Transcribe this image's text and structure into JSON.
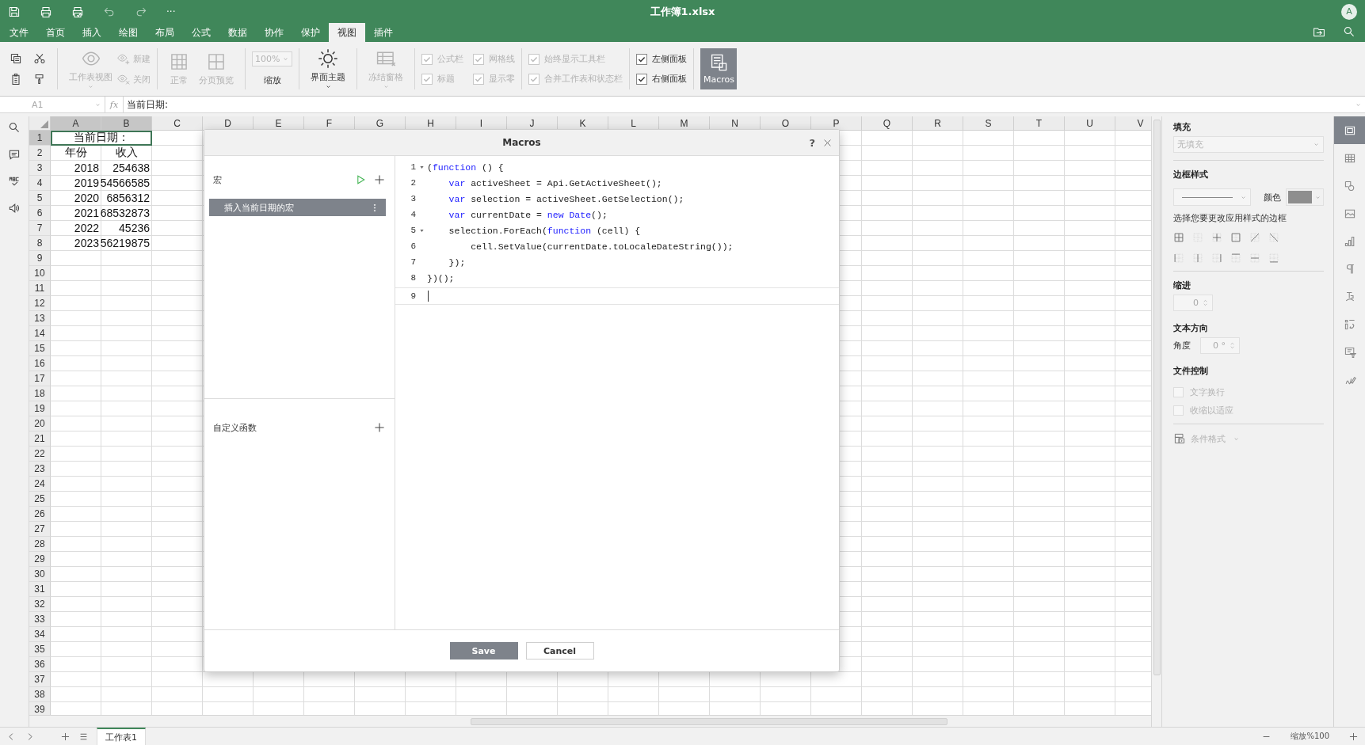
{
  "window": {
    "title": "工作簿1.xlsx",
    "more": "···",
    "avatar": "A"
  },
  "menu_tabs": [
    {
      "label": "文件",
      "selected": false
    },
    {
      "label": "首页",
      "selected": false
    },
    {
      "label": "插入",
      "selected": false
    },
    {
      "label": "绘图",
      "selected": false
    },
    {
      "label": "布局",
      "selected": false
    },
    {
      "label": "公式",
      "selected": false
    },
    {
      "label": "数据",
      "selected": false
    },
    {
      "label": "协作",
      "selected": false
    },
    {
      "label": "保护",
      "selected": false
    },
    {
      "label": "视图",
      "selected": true
    },
    {
      "label": "插件",
      "selected": false
    }
  ],
  "toolbar": {
    "sheet_view": {
      "label": "工作表视图",
      "disabled": true
    },
    "new_view": {
      "label": "新建",
      "disabled": true
    },
    "close_view": {
      "label": "关闭",
      "disabled": true
    },
    "normal": {
      "label": "正常",
      "disabled": true
    },
    "page_break": {
      "label": "分页预览",
      "disabled": true
    },
    "zoom": {
      "value": "100%",
      "label": "缩放",
      "disabled": true
    },
    "theme": {
      "label": "界面主题",
      "disabled": false
    },
    "freeze": {
      "label": "冻结窗格",
      "disabled": true
    },
    "checkbox_groups": [
      [
        {
          "label": "公式栏",
          "checked": true,
          "disabled": true
        },
        {
          "label": "标题",
          "checked": true,
          "disabled": true
        },
        {
          "label": "网格线",
          "checked": true,
          "disabled": true
        },
        {
          "label": "显示零",
          "checked": true,
          "disabled": true
        }
      ],
      [
        {
          "label": "始终显示工具栏",
          "checked": true,
          "disabled": true
        },
        {
          "label": "合并工作表和状态栏",
          "checked": true,
          "disabled": true
        }
      ],
      [
        {
          "label": "左侧面板",
          "checked": true,
          "disabled": false
        },
        {
          "label": "右侧面板",
          "checked": true,
          "disabled": false
        }
      ]
    ],
    "macros": {
      "label": "Macros",
      "selected": true
    }
  },
  "formula_bar": {
    "cell_ref": "A1",
    "fx": "fx",
    "value": "当前日期:"
  },
  "sheet": {
    "columns": [
      {
        "label": "A",
        "selected": true
      },
      {
        "label": "B",
        "selected": true
      },
      {
        "label": "C",
        "selected": false
      },
      {
        "label": "D",
        "selected": false
      },
      {
        "label": "E",
        "selected": false
      },
      {
        "label": "F",
        "selected": false
      },
      {
        "label": "G",
        "selected": false
      },
      {
        "label": "H",
        "selected": false
      },
      {
        "label": "I",
        "selected": false
      },
      {
        "label": "J",
        "selected": false
      },
      {
        "label": "K",
        "selected": false
      },
      {
        "label": "L",
        "selected": false
      },
      {
        "label": "M",
        "selected": false
      },
      {
        "label": "N",
        "selected": false
      },
      {
        "label": "O",
        "selected": false
      },
      {
        "label": "P",
        "selected": false
      },
      {
        "label": "Q",
        "selected": false
      },
      {
        "label": "R",
        "selected": false
      },
      {
        "label": "S",
        "selected": false
      },
      {
        "label": "T",
        "selected": false
      },
      {
        "label": "U",
        "selected": false
      },
      {
        "label": "V",
        "selected": false
      }
    ],
    "rows": [
      {
        "header": "1",
        "selected": true,
        "cells": [
          {
            "text": "当前日期：",
            "kind": "merged",
            "selected": true
          }
        ]
      },
      {
        "header": "2",
        "selected": false,
        "cells": [
          {
            "text": "年份",
            "kind": "text",
            "selected": false
          },
          {
            "text": "收入",
            "kind": "text",
            "selected": false
          }
        ]
      },
      {
        "header": "3",
        "selected": false,
        "cells": [
          {
            "text": "2018",
            "kind": "number",
            "selected": false
          },
          {
            "text": "254638",
            "kind": "number",
            "selected": false
          }
        ]
      },
      {
        "header": "4",
        "selected": false,
        "cells": [
          {
            "text": "2019",
            "kind": "number",
            "selected": false
          },
          {
            "text": "54566585",
            "kind": "number",
            "selected": false
          }
        ]
      },
      {
        "header": "5",
        "selected": false,
        "cells": [
          {
            "text": "2020",
            "kind": "number",
            "selected": false
          },
          {
            "text": "6856312",
            "kind": "number",
            "selected": false
          }
        ]
      },
      {
        "header": "6",
        "selected": false,
        "cells": [
          {
            "text": "2021",
            "kind": "number",
            "selected": false
          },
          {
            "text": "68532873",
            "kind": "number",
            "selected": false
          }
        ]
      },
      {
        "header": "7",
        "selected": false,
        "cells": [
          {
            "text": "2022",
            "kind": "number",
            "selected": false
          },
          {
            "text": "45236",
            "kind": "number",
            "selected": false
          }
        ]
      },
      {
        "header": "8",
        "selected": false,
        "cells": [
          {
            "text": "2023",
            "kind": "number",
            "selected": false
          },
          {
            "text": "56219875",
            "kind": "number",
            "selected": false
          }
        ]
      },
      {
        "header": "9",
        "selected": false
      },
      {
        "header": "10",
        "selected": false
      },
      {
        "header": "11",
        "selected": false
      },
      {
        "header": "12",
        "selected": false
      },
      {
        "header": "13",
        "selected": false
      },
      {
        "header": "14",
        "selected": false
      },
      {
        "header": "15",
        "selected": false
      },
      {
        "header": "16",
        "selected": false
      },
      {
        "header": "17",
        "selected": false
      },
      {
        "header": "18",
        "selected": false
      },
      {
        "header": "19",
        "selected": false
      },
      {
        "header": "20",
        "selected": false
      },
      {
        "header": "21",
        "selected": false
      },
      {
        "header": "22",
        "selected": false
      },
      {
        "header": "23",
        "selected": false
      },
      {
        "header": "24",
        "selected": false
      },
      {
        "header": "25",
        "selected": false
      },
      {
        "header": "26",
        "selected": false
      },
      {
        "header": "27",
        "selected": false
      },
      {
        "header": "28",
        "selected": false
      },
      {
        "header": "29",
        "selected": false
      },
      {
        "header": "30",
        "selected": false
      },
      {
        "header": "31",
        "selected": false
      },
      {
        "header": "32",
        "selected": false
      },
      {
        "header": "33",
        "selected": false
      },
      {
        "header": "34",
        "selected": false
      },
      {
        "header": "35",
        "selected": false
      },
      {
        "header": "36",
        "selected": false
      },
      {
        "header": "37",
        "selected": false
      },
      {
        "header": "38",
        "selected": false
      },
      {
        "header": "39",
        "selected": false
      }
    ]
  },
  "dialog": {
    "title": "Macros",
    "help": "?",
    "macros_heading": "宏",
    "macros": [
      {
        "label": "插入当前日期的宏",
        "selected": true
      }
    ],
    "functions_heading": "自定义函数",
    "code": [
      {
        "number": "1",
        "fold": true,
        "active": false,
        "tokens": [
          {
            "t": "(",
            "keyword": false
          },
          {
            "t": "function",
            "keyword": true
          },
          {
            "t": " () {",
            "keyword": false
          }
        ]
      },
      {
        "number": "2",
        "fold": false,
        "active": false,
        "tokens": [
          {
            "t": "    var",
            "keyword": true
          },
          {
            "t": " activeSheet = Api.GetActiveSheet();",
            "keyword": false
          }
        ]
      },
      {
        "number": "3",
        "fold": false,
        "active": false,
        "tokens": [
          {
            "t": "    var",
            "keyword": true
          },
          {
            "t": " selection = activeSheet.GetSelection();",
            "keyword": false
          }
        ]
      },
      {
        "number": "4",
        "fold": false,
        "active": false,
        "tokens": [
          {
            "t": "    var",
            "keyword": true
          },
          {
            "t": " currentDate = ",
            "keyword": false
          },
          {
            "t": "new",
            "keyword": true
          },
          {
            "t": " Date",
            "keyword": true
          },
          {
            "t": "();",
            "keyword": false
          }
        ]
      },
      {
        "number": "5",
        "fold": true,
        "active": false,
        "tokens": [
          {
            "t": "    selection.ForEach(",
            "keyword": false
          },
          {
            "t": "function",
            "keyword": true
          },
          {
            "t": " (cell) {",
            "keyword": false
          }
        ]
      },
      {
        "number": "6",
        "fold": false,
        "active": false,
        "tokens": [
          {
            "t": "        cell.SetValue(currentDate.toLocaleDateString());",
            "keyword": false
          }
        ]
      },
      {
        "number": "7",
        "fold": false,
        "active": false,
        "tokens": [
          {
            "t": "    });",
            "keyword": false
          }
        ]
      },
      {
        "number": "8",
        "fold": false,
        "active": false,
        "tokens": [
          {
            "t": "})();",
            "keyword": false
          }
        ]
      },
      {
        "number": "9",
        "fold": false,
        "active": true
      }
    ],
    "buttons": [
      {
        "label": "Save",
        "kind": "primary"
      },
      {
        "label": "Cancel",
        "kind": "secondary"
      }
    ]
  },
  "right_panel": {
    "fill_heading": "填充",
    "fill_value": "无填充",
    "border_heading": "边框样式",
    "color_label": "颜色",
    "color_swatch": {
      "color": "#8e8e8e"
    },
    "border_hint": "选择您要更改应用样式的边框",
    "indent_heading": "缩进",
    "indent_value": "0",
    "direction_heading": "文本方向",
    "angle_label": "角度",
    "angle_value": "0 °",
    "control_heading": "文件控制",
    "options": [
      {
        "label": "文字换行",
        "checked": false,
        "disabled": true
      },
      {
        "label": "收缩以适应",
        "checked": false,
        "disabled": true
      }
    ],
    "conditional": {
      "label": "条件格式",
      "disabled": true
    }
  },
  "right_rail": [
    {
      "selected": true
    },
    {
      "selected": false
    },
    {
      "selected": false
    },
    {
      "selected": false
    },
    {
      "selected": false
    },
    {
      "selected": false
    },
    {
      "selected": false
    },
    {
      "selected": false
    },
    {
      "selected": false
    },
    {
      "selected": false
    }
  ],
  "status_bar": {
    "sheets": [
      {
        "label": "工作表1",
        "selected": true
      }
    ],
    "zoom": "缩放%100"
  }
}
